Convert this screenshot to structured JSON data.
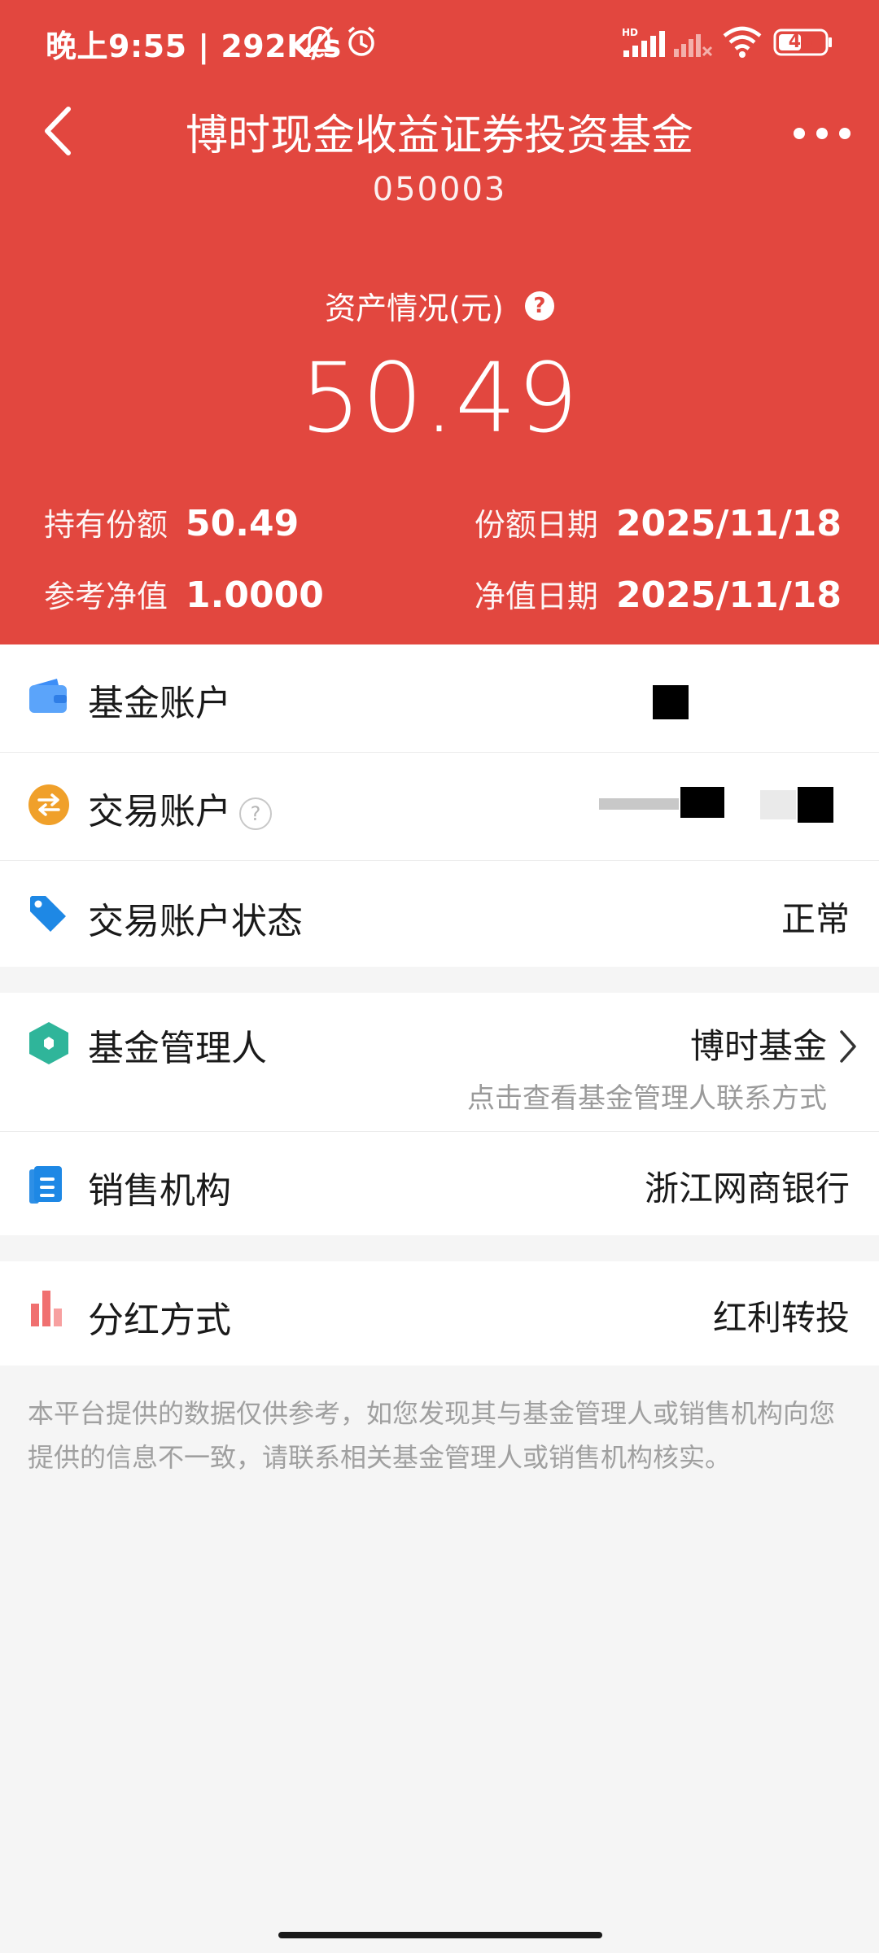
{
  "status_bar": {
    "time_speed": "晚上9:55 | 292K/s",
    "battery": "45"
  },
  "header": {
    "title": "博时现金收益证券投资基金",
    "code": "050003",
    "asset_label": "资产情况(元)",
    "asset_help": "?",
    "asset_value": "50.49",
    "holding_label": "持有份额",
    "holding_value": "50.49",
    "share_date_label": "份额日期",
    "share_date_value": "2025/11/18",
    "nav_label": "参考净值",
    "nav_value": "1.0000",
    "nav_date_label": "净值日期",
    "nav_date_value": "2025/11/18"
  },
  "accounts": {
    "fund_account_label": "基金账户",
    "trade_account_label": "交易账户",
    "trade_account_help": "?",
    "trade_status_label": "交易账户状态",
    "trade_status_value": "正常"
  },
  "manager": {
    "manager_label": "基金管理人",
    "manager_value": "博时基金",
    "manager_hint": "点击查看基金管理人联系方式",
    "sales_label": "销售机构",
    "sales_value": "浙江网商银行"
  },
  "dividend": {
    "label": "分红方式",
    "value": "红利转投"
  },
  "disclaimer": "本平台提供的数据仅供参考，如您发现其与基金管理人或销售机构向您提供的信息不一致，请联系相关基金管理人或销售机构核实。",
  "colors": {
    "brand_red": "#e2473f",
    "wallet_blue": "#3d8ef7",
    "exchange_orange": "#f0a02a",
    "tag_blue": "#1e88e5",
    "hex_teal": "#2fb59a",
    "bars_red": "#f07070"
  }
}
